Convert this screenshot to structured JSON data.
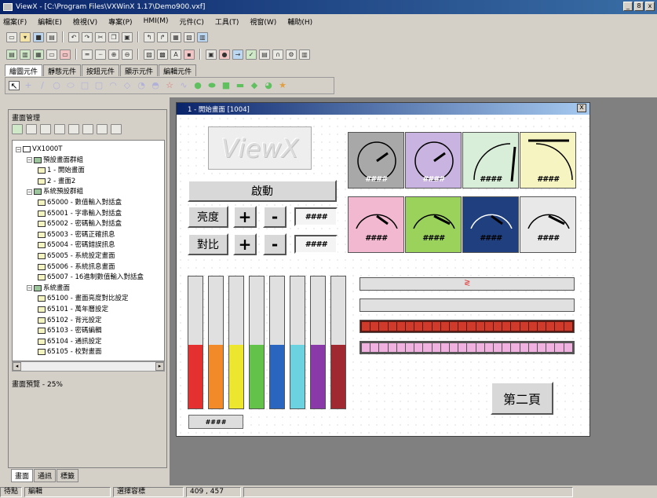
{
  "window": {
    "title": "ViewX - [C:\\Program Files\\VXWinX 1.17\\Demo900.vxf]",
    "min_label": "_",
    "max_label": "8",
    "close_label": "x"
  },
  "menu": [
    "檔案(F)",
    "編輯(E)",
    "檢視(V)",
    "專案(P)",
    "HMI(M)",
    "元件(C)",
    "工具(T)",
    "視窗(W)",
    "輔助(H)"
  ],
  "component_tabs": [
    "繪圖元件",
    "靜態元件",
    "按鈕元件",
    "顯示元件",
    "編輯元件"
  ],
  "left_panel": {
    "title": "畫面管理",
    "tree": [
      {
        "label": "VX1000T",
        "level": 0,
        "icon": "device"
      },
      {
        "label": "預設畫面群組",
        "level": 1,
        "icon": "group"
      },
      {
        "label": "1 - 開始畫面",
        "level": 2,
        "icon": "screen"
      },
      {
        "label": "2 - 畫面2",
        "level": 2,
        "icon": "screen"
      },
      {
        "label": "系統預設群組",
        "level": 1,
        "icon": "group"
      },
      {
        "label": "65000 - 數值輸入對話盒",
        "level": 2,
        "icon": "screen"
      },
      {
        "label": "65001 - 字串輸入對話盒",
        "level": 2,
        "icon": "screen"
      },
      {
        "label": "65002 - 密碼輸入對話盒",
        "level": 2,
        "icon": "screen"
      },
      {
        "label": "65003 - 密碼正確訊息",
        "level": 2,
        "icon": "screen"
      },
      {
        "label": "65004 - 密碼錯誤訊息",
        "level": 2,
        "icon": "screen"
      },
      {
        "label": "65005 - 系統設定畫面",
        "level": 2,
        "icon": "screen"
      },
      {
        "label": "65006 - 系統訊息畫面",
        "level": 2,
        "icon": "screen"
      },
      {
        "label": "65007 - 16進制數值輸入對話盒",
        "level": 2,
        "icon": "screen"
      },
      {
        "label": "系統畫面",
        "level": 1,
        "icon": "group"
      },
      {
        "label": "65100 - 畫面亮度對比設定",
        "level": 2,
        "icon": "screen"
      },
      {
        "label": "65101 - 萬年曆設定",
        "level": 2,
        "icon": "screen"
      },
      {
        "label": "65102 - 背光設定",
        "level": 2,
        "icon": "screen"
      },
      {
        "label": "65103 - 密碼編輯",
        "level": 2,
        "icon": "screen"
      },
      {
        "label": "65104 - 通訊設定",
        "level": 2,
        "icon": "screen"
      },
      {
        "label": "65105 - 校對畫面",
        "level": 2,
        "icon": "screen"
      }
    ],
    "preview_label": "畫面預覽 - 25%",
    "bottom_tabs": [
      "畫面",
      "通訊",
      "標籤"
    ]
  },
  "status": {
    "ready": "待點",
    "mode": "編輯",
    "action": "選擇容標",
    "coords": "409 , 457"
  },
  "child_window": {
    "title": "1 - 開始畫面 [1004]",
    "close_label": "x",
    "logo_text": "ViewX",
    "start_label": "啟動",
    "brightness_label": "亮度",
    "contrast_label": "對比",
    "plus_label": "+",
    "minus_label": "-",
    "hash": "####",
    "page2_label": "第二頁",
    "small_box": "####"
  },
  "meters": {
    "top_colors": [
      "#a8a8a8",
      "#c9b3e0",
      "#d9eed9",
      "#f6f4c0"
    ],
    "bottom_colors": [
      "#f2b8d0",
      "#9bd25b",
      "#1f3f7f",
      "#e8e8e8"
    ]
  },
  "vbars": [
    {
      "color": "#e53030",
      "level": 0.48
    },
    {
      "color": "#f28a2a",
      "level": 0.48
    },
    {
      "color": "#ece72e",
      "level": 0.48
    },
    {
      "color": "#62c24a",
      "level": 0.48
    },
    {
      "color": "#2a66c0",
      "level": 0.48
    },
    {
      "color": "#6dd2e0",
      "level": 0.48
    },
    {
      "color": "#8a3aa8",
      "level": 0.48
    },
    {
      "color": "#a02830",
      "level": 0.48
    }
  ],
  "hbars": {
    "seg_red": "#d03a2a",
    "seg_pink": "#f0b0e0"
  }
}
